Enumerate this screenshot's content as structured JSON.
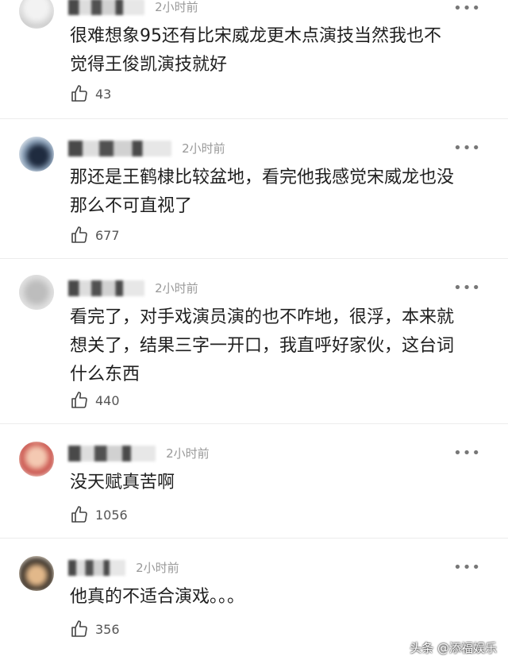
{
  "comments": [
    {
      "time": "2小时前",
      "more": "•••",
      "text": "很难想象95还有比宋威龙更木点演技当然我也不\n觉得王俊凯演技就好",
      "likes": "43"
    },
    {
      "time": "2小时前",
      "more": "•••",
      "text": "那还是王鹤棣比较盆地，看完他我感觉宋威龙也没\n那么不可直视了",
      "likes": "677"
    },
    {
      "time": "2小时前",
      "more": "•••",
      "text": "看完了，对手戏演员演的也不咋地，很浮，本来就\n想关了，结果三字一开口，我直呼好家伙，这台词\n什么东西",
      "likes": "440"
    },
    {
      "time": "2小时前",
      "more": "•••",
      "text": "没天赋真苦啊",
      "likes": "1056"
    },
    {
      "time": "2小时前",
      "more": "•••",
      "text": "他真的不适合演戏。。。",
      "likes": "356"
    }
  ],
  "watermark": "头条 @添福娱乐"
}
